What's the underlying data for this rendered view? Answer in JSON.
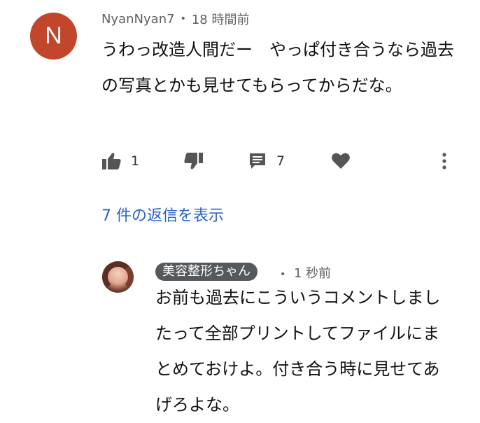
{
  "comment": {
    "avatar_letter": "N",
    "avatar_color": "#c2462b",
    "author": "NyanNyan7",
    "separator": "•",
    "time": "18 時間前",
    "text": "うわっ改造人間だー　やっぱ付き合うなら過去の写真とかも見せてもらってからだな。",
    "likes": "1",
    "replies_count": "7",
    "icons": [
      "thumb-up-icon",
      "thumb-down-icon",
      "reply-icon",
      "heart-icon",
      "more-icon"
    ]
  },
  "view_replies": "7 件の返信を表示",
  "reply": {
    "author": "美容整形ちゃん",
    "separator": "•",
    "time": "1 秒前",
    "text": "お前も過去にこういうコメントしましたって全部プリントしてファイルにまとめておけよ。付き合う時に見せてあげろよな。"
  },
  "colors": {
    "link": "#2a63c6",
    "meta": "#606060",
    "name_badge": "#55595c"
  }
}
